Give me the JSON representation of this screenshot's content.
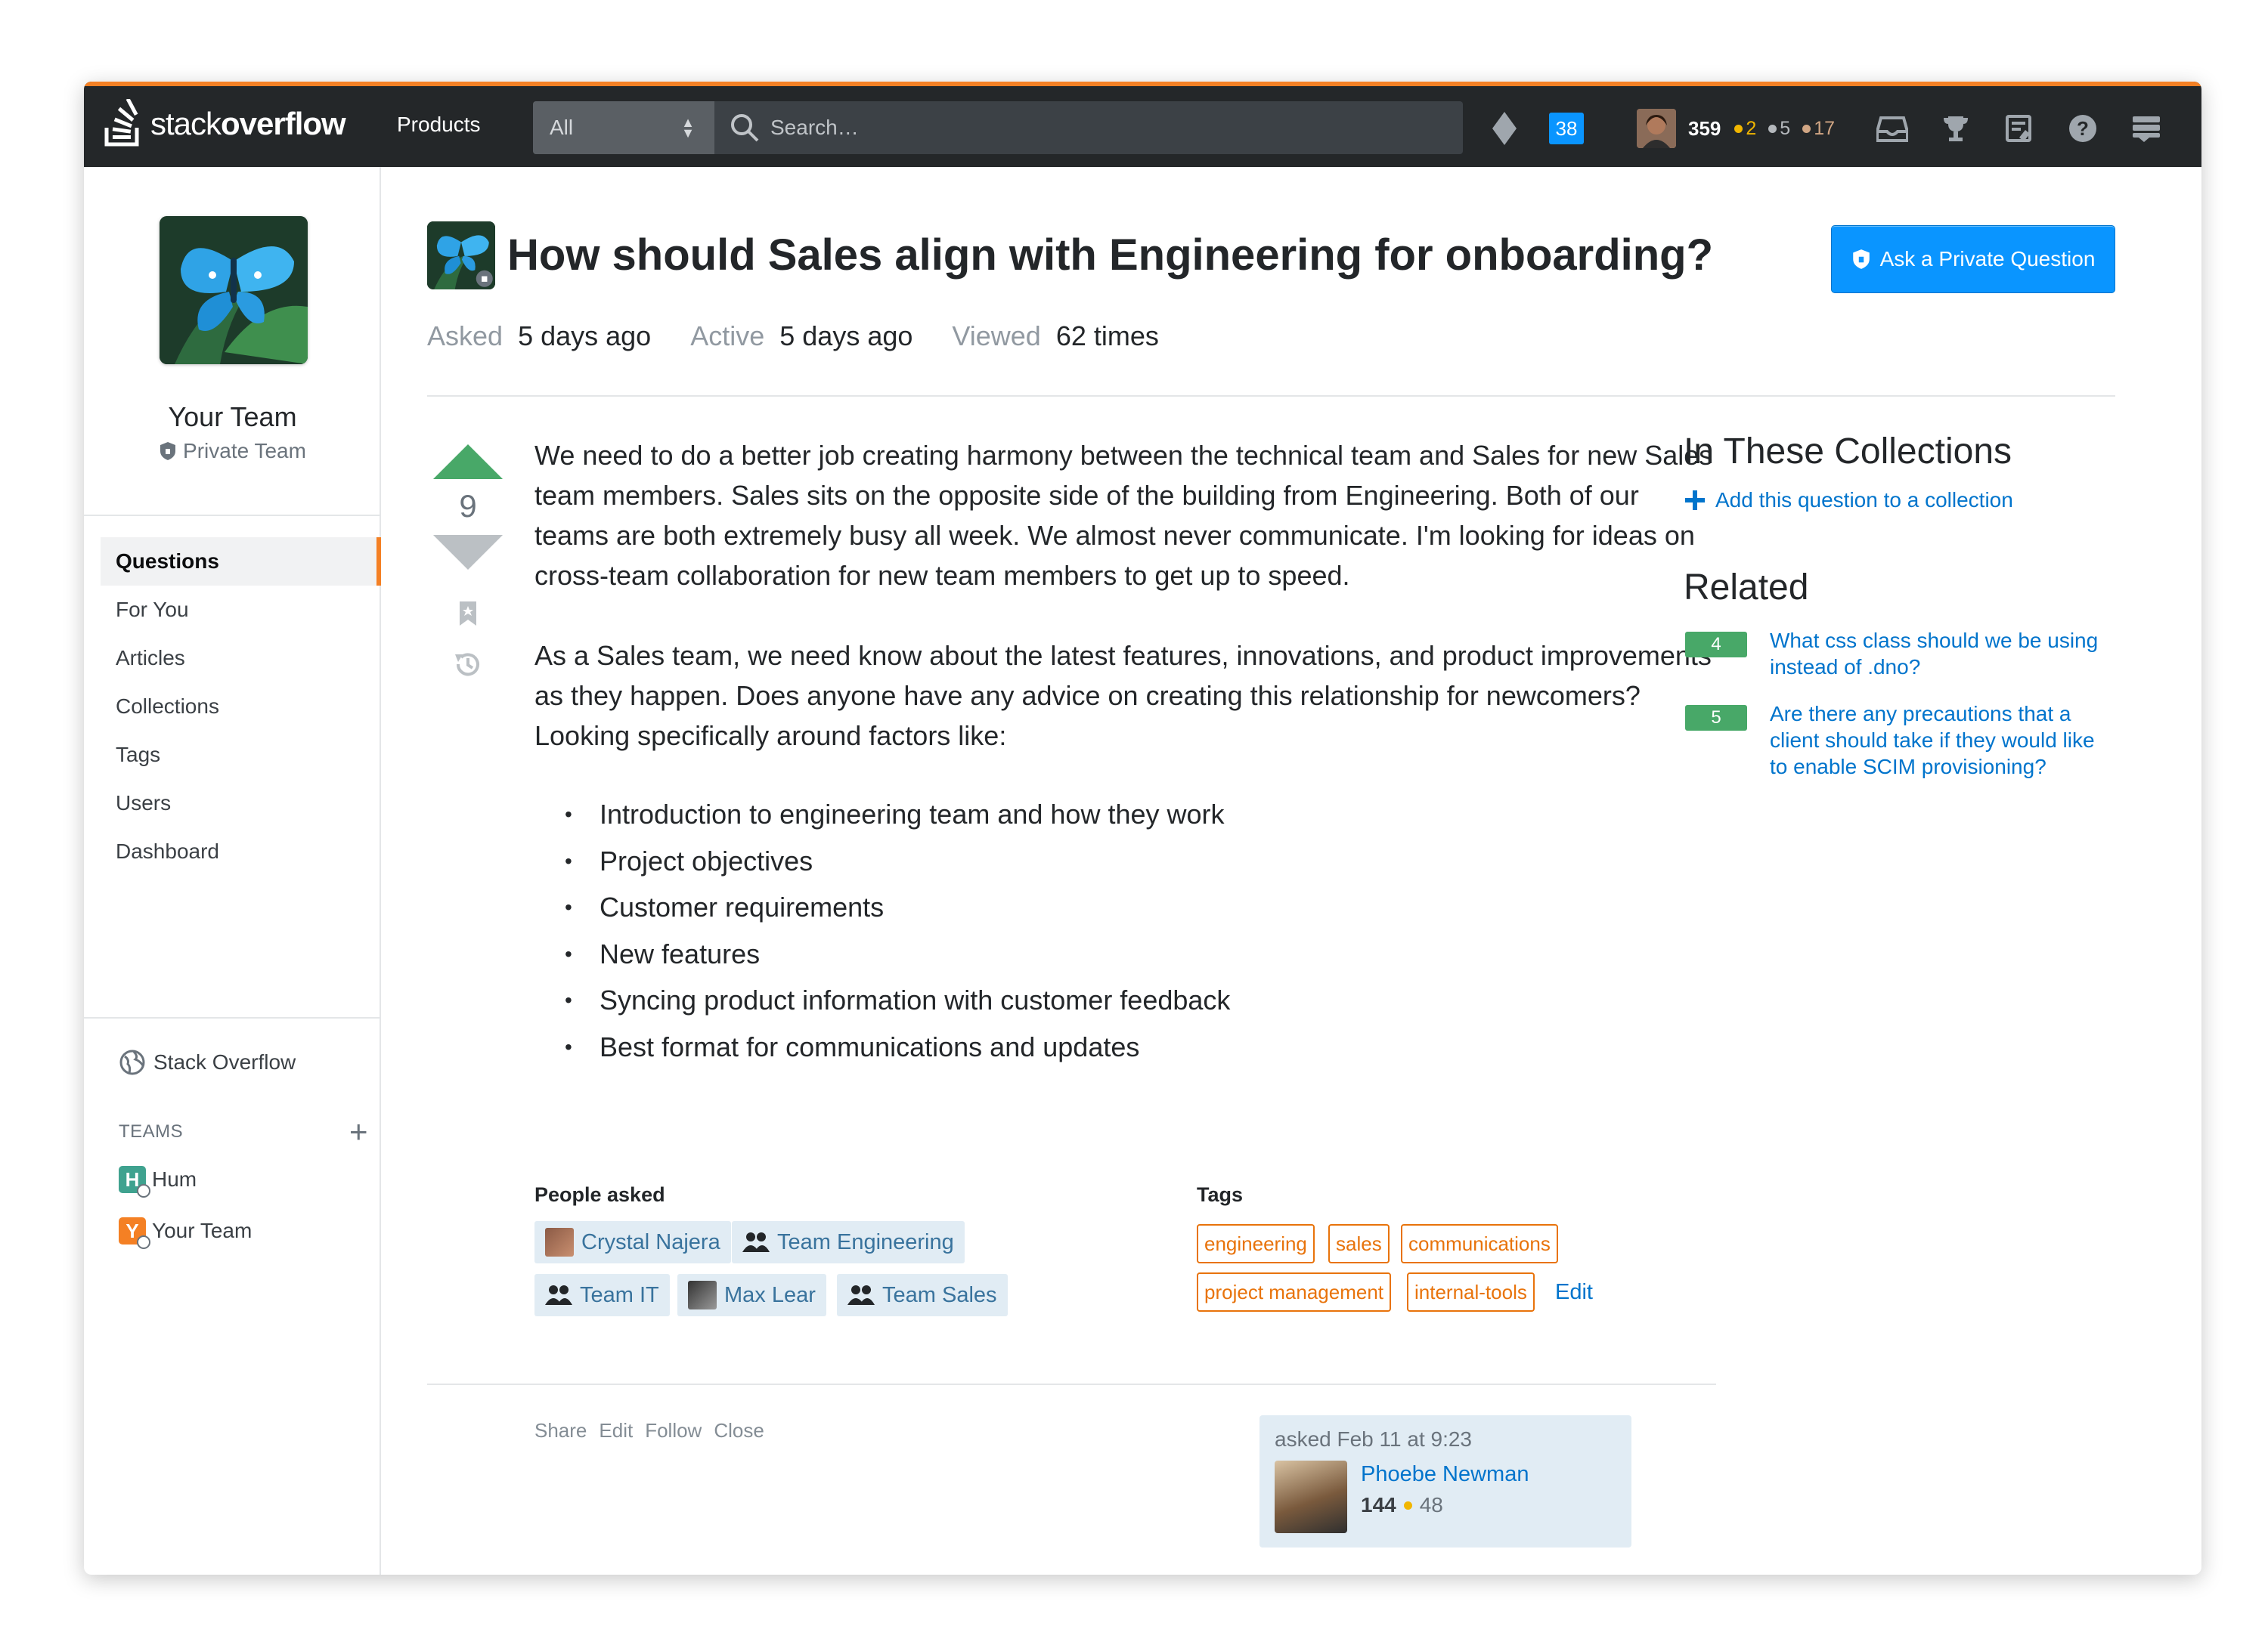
{
  "topbar": {
    "logo_plain": "stack",
    "logo_bold": "overflow",
    "products_label": "Products",
    "search_scope": "All",
    "search_placeholder": "Search…",
    "inbox_count": "38",
    "reputation": "359",
    "gold_badges": "2",
    "silver_badges": "5",
    "bronze_badges": "17",
    "colors": {
      "bar": "#242729",
      "accent": "#f48024",
      "inbox": "#0a95ff",
      "gold": "#f1b600",
      "silver": "#b4b8bc",
      "bronze": "#d1a684"
    }
  },
  "sidebar": {
    "team_name": "Your Team",
    "team_type": "Private Team",
    "nav": [
      {
        "label": "Questions",
        "active": true
      },
      {
        "label": "For You"
      },
      {
        "label": "Articles"
      },
      {
        "label": "Collections"
      },
      {
        "label": "Tags"
      },
      {
        "label": "Users"
      },
      {
        "label": "Dashboard"
      }
    ],
    "stack_overflow_label": "Stack Overflow",
    "teams_header": "TEAMS",
    "teams": [
      {
        "initial": "H",
        "name": "Hum",
        "color": "#3fa28f"
      },
      {
        "initial": "Y",
        "name": "Your Team",
        "color": "#f48024"
      }
    ]
  },
  "question": {
    "title": "How should Sales align with Engineering for onboarding?",
    "ask_button": "Ask a Private Question",
    "asked_label": "Asked",
    "asked_value": "5 days ago",
    "active_label": "Active",
    "active_value": "5 days ago",
    "viewed_label": "Viewed",
    "viewed_value": "62 times",
    "votes": "9",
    "body": [
      "We need to do a better job creating harmony between the technical team and Sales for new Sales team members. Sales sits on the opposite side of the building from Engineering. Both of our teams are both extremely busy all week. We almost never communicate. I'm looking for ideas on cross-team collaboration for new team members to get up to speed.",
      "As a Sales team, we need know about the latest features, innovations, and product improvements as they happen. Does anyone have any advice on creating this relationship for newcomers? Looking specifically around factors like:"
    ],
    "bullets": [
      "Introduction to engineering team and how they work",
      "Project objectives",
      "Customer requirements",
      "New features",
      "Syncing product information with customer feedback",
      "Best format for communications and updates"
    ],
    "people_asked_label": "People asked",
    "people_asked": [
      {
        "name": "Crystal Najera",
        "kind": "user"
      },
      {
        "name": "Team Engineering",
        "kind": "team"
      },
      {
        "name": "Team IT",
        "kind": "team"
      },
      {
        "name": "Max Lear",
        "kind": "user"
      },
      {
        "name": "Team Sales",
        "kind": "team"
      }
    ],
    "tags_label": "Tags",
    "tags": [
      "engineering",
      "sales",
      "communications",
      "project management",
      "internal-tools"
    ],
    "tags_edit": "Edit",
    "menu": [
      "Share",
      "Edit",
      "Follow",
      "Close"
    ],
    "owner": {
      "asked_text": "asked Feb 11 at 9:23",
      "name": "Phoebe Newman",
      "reputation": "144",
      "gold_badges": "48"
    }
  },
  "right_column": {
    "collections_title": "In These Collections",
    "add_to_collection": "Add this question to a collection",
    "related_title": "Related",
    "related": [
      {
        "score": "4",
        "title": "What css class should we be using instead of .dno?"
      },
      {
        "score": "5",
        "title": "Are there any precautions that a client should take if they would like to enable SCIM provisioning?"
      }
    ]
  }
}
